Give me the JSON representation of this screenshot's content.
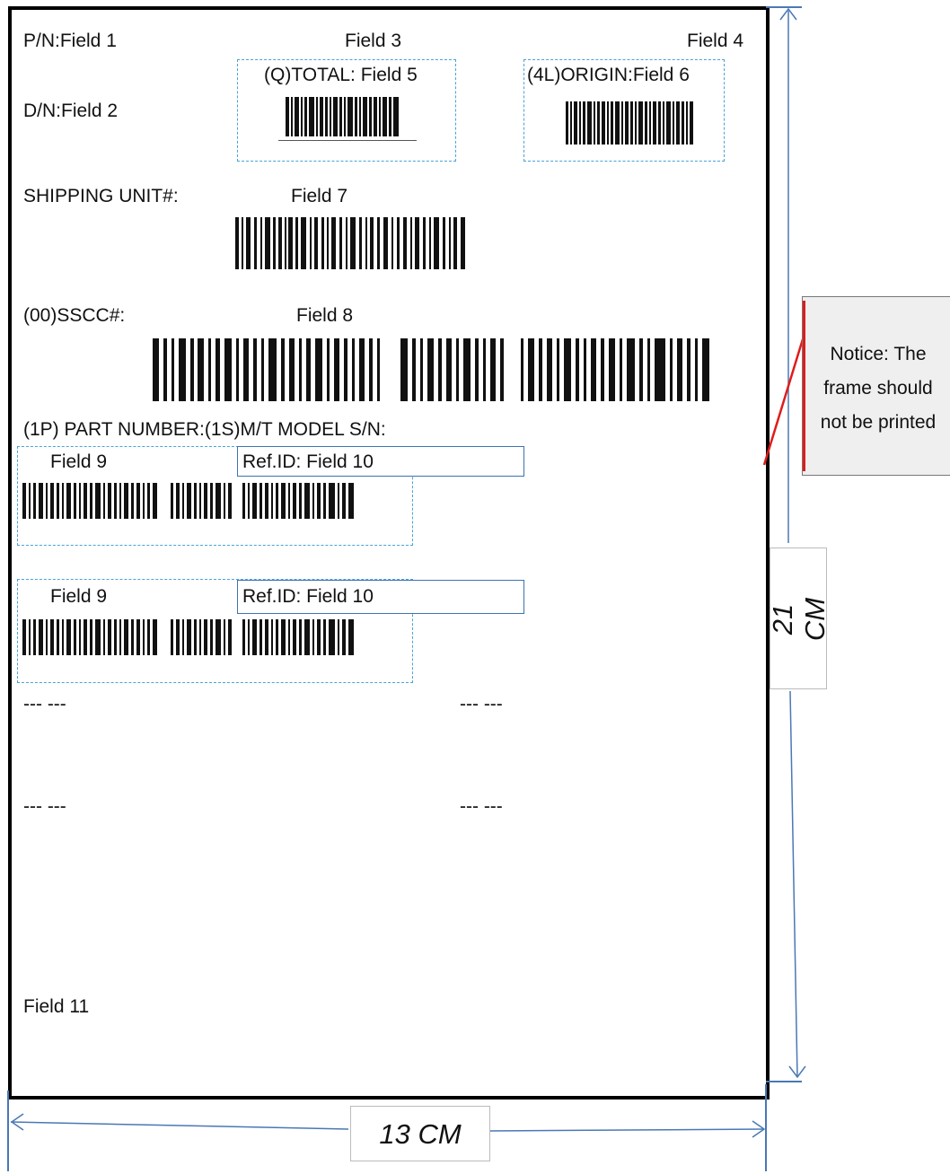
{
  "label": {
    "pn": "P/N:Field 1",
    "dn": "D/N:Field 2",
    "field3": "Field 3",
    "field4": "Field 4",
    "total": "(Q)TOTAL: Field 5",
    "origin": "(4L)ORIGIN:Field 6",
    "shipping_unit": "SHIPPING UNIT#:",
    "field7": "Field 7",
    "sscc": "(00)SSCC#:",
    "field8": "Field 8",
    "part_header": "(1P) PART NUMBER:(1S)M/T MODEL S/N:",
    "parts": [
      {
        "field": "Field 9",
        "ref": "Ref.ID: Field 10"
      },
      {
        "field": "Field 9",
        "ref": "Ref.ID: Field 10"
      }
    ],
    "placeholders": [
      "--- ---",
      "--- ---",
      "--- ---",
      "--- ---"
    ],
    "field11": "Field 11"
  },
  "notice": {
    "lines": [
      "Notice: The",
      "frame should",
      "not be printed"
    ]
  },
  "dimensions": {
    "height": "21 CM",
    "width": "13 CM"
  },
  "colors": {
    "frame": "#000000",
    "dashed_box": "#4aa3d6",
    "dimension_line": "#4a78b5",
    "notice_pointer": "#e01b1b"
  }
}
